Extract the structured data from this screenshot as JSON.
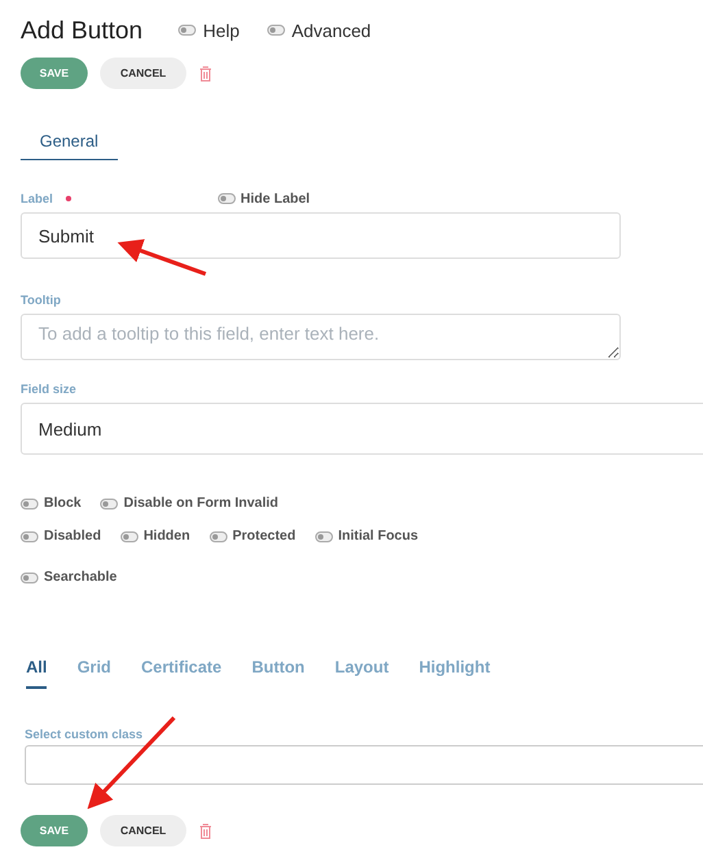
{
  "title": "Add Button",
  "header_toggles": [
    {
      "label": "Help",
      "on": false
    },
    {
      "label": "Advanced",
      "on": false
    }
  ],
  "top_actions": {
    "save": "SAVE",
    "cancel": "CANCEL"
  },
  "tabs": [
    {
      "label": "General",
      "selected": true
    }
  ],
  "fields": [
    {
      "kind": "input",
      "label": "Label",
      "required": true,
      "toggle": {
        "label": "Hide Label",
        "on": false
      },
      "value": "Submit"
    },
    {
      "kind": "textarea",
      "label": "Tooltip",
      "required": false,
      "placeholder": "To add a tooltip to this field, enter text here."
    },
    {
      "kind": "select",
      "label": "Field size",
      "required": false,
      "value": "Medium"
    }
  ],
  "option_rows": [
    [
      {
        "label": "Block",
        "on": false
      },
      {
        "label": "Disable on Form Invalid",
        "on": false
      }
    ],
    [
      {
        "label": "Disabled",
        "on": false
      },
      {
        "label": "Hidden",
        "on": false
      },
      {
        "label": "Protected",
        "on": false
      },
      {
        "label": "Initial Focus",
        "on": false
      }
    ],
    [
      {
        "label": "Searchable",
        "on": false
      }
    ]
  ],
  "class_tabs": [
    {
      "label": "All",
      "selected": true
    },
    {
      "label": "Grid",
      "selected": false
    },
    {
      "label": "Certificate",
      "selected": false
    },
    {
      "label": "Button",
      "selected": false
    },
    {
      "label": "Layout",
      "selected": false
    },
    {
      "label": "Highlight",
      "selected": false
    }
  ],
  "custom_class": {
    "label": "Select custom class"
  },
  "bottom_actions": {
    "save": "SAVE",
    "cancel": "CANCEL"
  }
}
